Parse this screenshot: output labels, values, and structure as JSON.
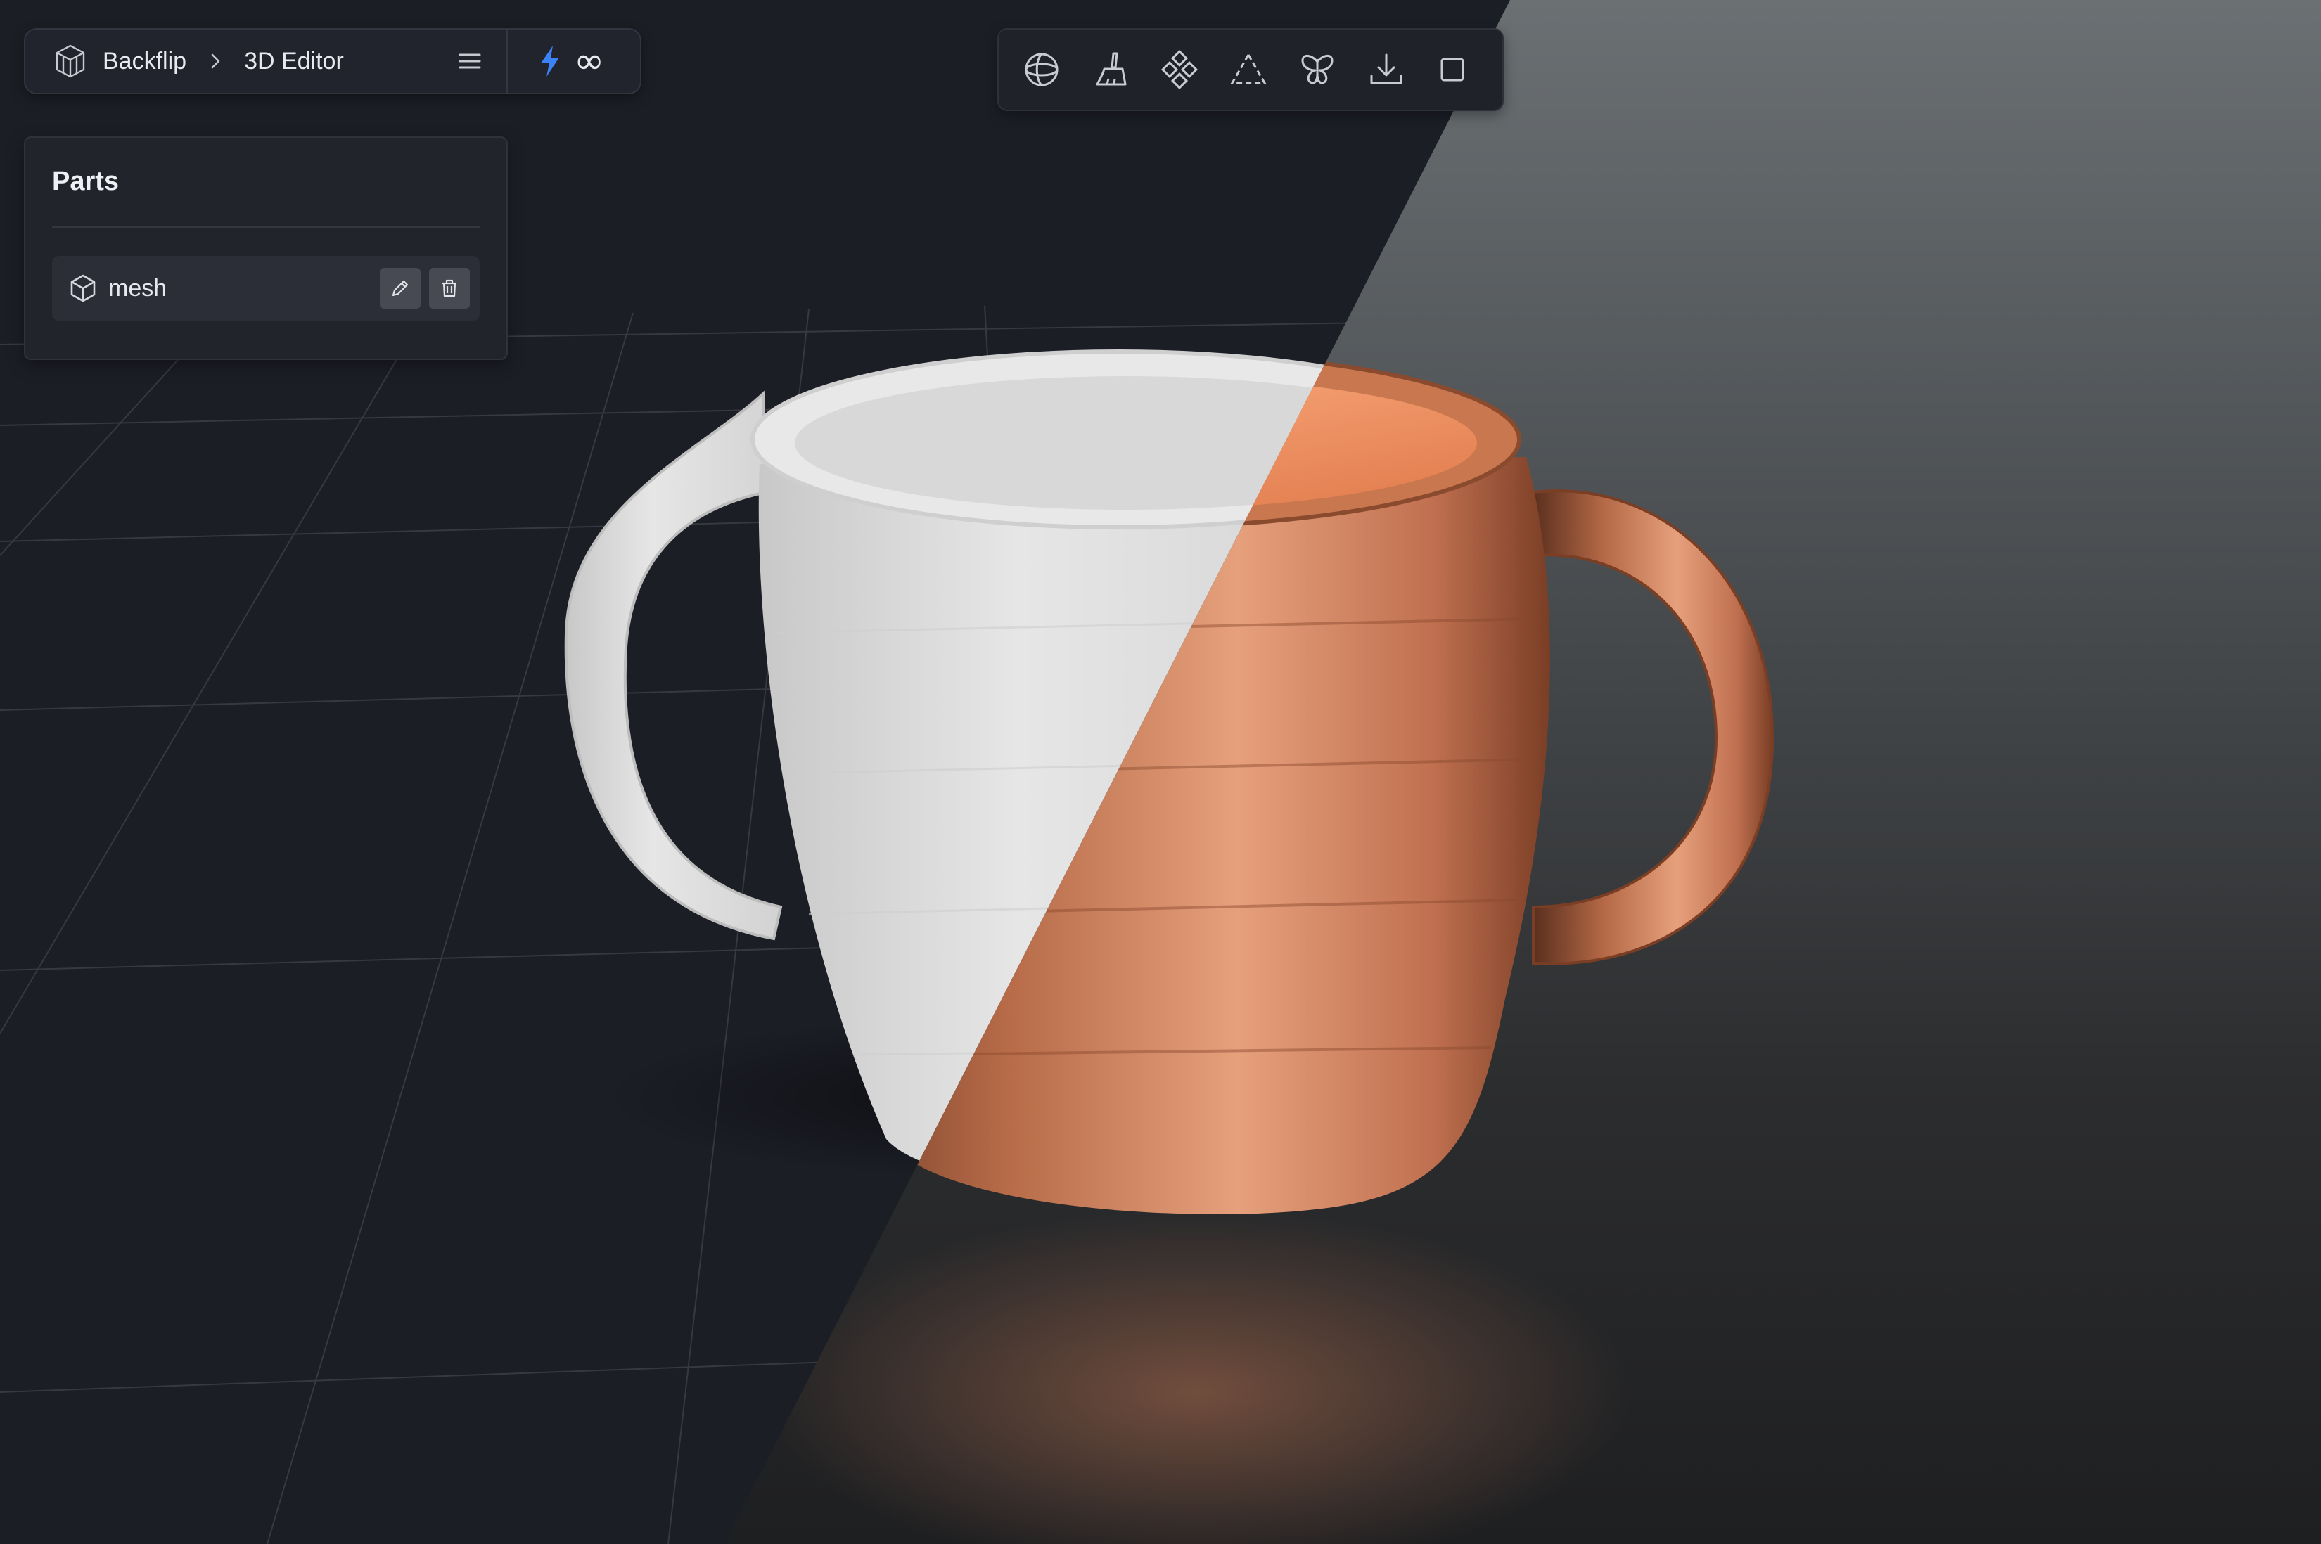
{
  "header": {
    "logo_icon": "cube-stack-icon",
    "app_name": "Backflip",
    "separator_icon": "chevron-right-icon",
    "page_name": "3D Editor",
    "menu_icon": "hamburger-menu-icon",
    "credits_icon": "lightning-bolt-icon",
    "credits_value": "∞",
    "accent_color": "#3b82f6"
  },
  "toolbar": {
    "tools": [
      {
        "icon": "sphere-icon"
      },
      {
        "icon": "paint-brush-icon"
      },
      {
        "icon": "diamond-grid-icon"
      },
      {
        "icon": "triangle-dashed-icon"
      },
      {
        "icon": "butterfly-icon"
      },
      {
        "icon": "download-icon"
      },
      {
        "icon": "square-icon"
      }
    ]
  },
  "parts": {
    "title": "Parts",
    "items": [
      {
        "name": "mesh",
        "icon": "cube-icon",
        "edit_icon": "pencil-icon",
        "delete_icon": "trash-icon"
      }
    ]
  },
  "viewport": {
    "object": "two-handled mug",
    "left_material": "clay-render",
    "right_material": "copper-render",
    "colors": {
      "clay": "#dedede",
      "copper": "#c8744f",
      "grid_bg": "#1c1e26",
      "photo_bg": "#5f6466"
    }
  }
}
